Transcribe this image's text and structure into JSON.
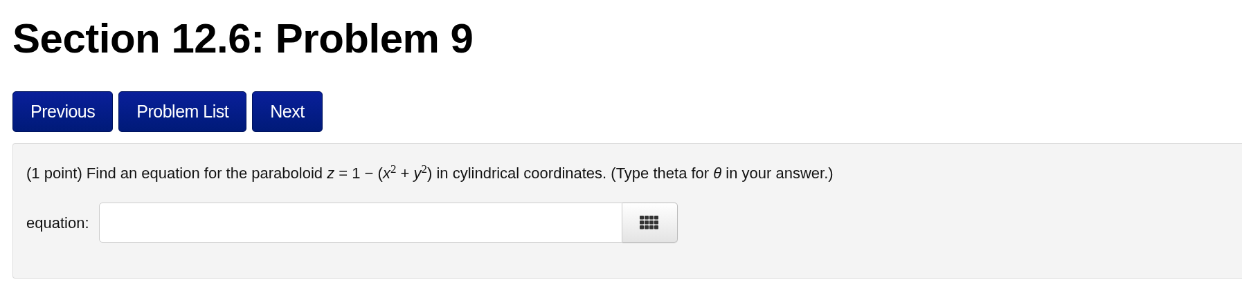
{
  "title": "Section 12.6: Problem 9",
  "nav_buttons": [
    "Previous",
    "Problem List",
    "Next"
  ],
  "problem": {
    "statement": "(1 point) Find an equation for the paraboloid *z* = 1 − (*x*$^{2}$ + *y*$^{2}$) in cylindrical coordinates. (Type theta for *θ* in your answer.)",
    "answer_label": "equation:"
  }
}
